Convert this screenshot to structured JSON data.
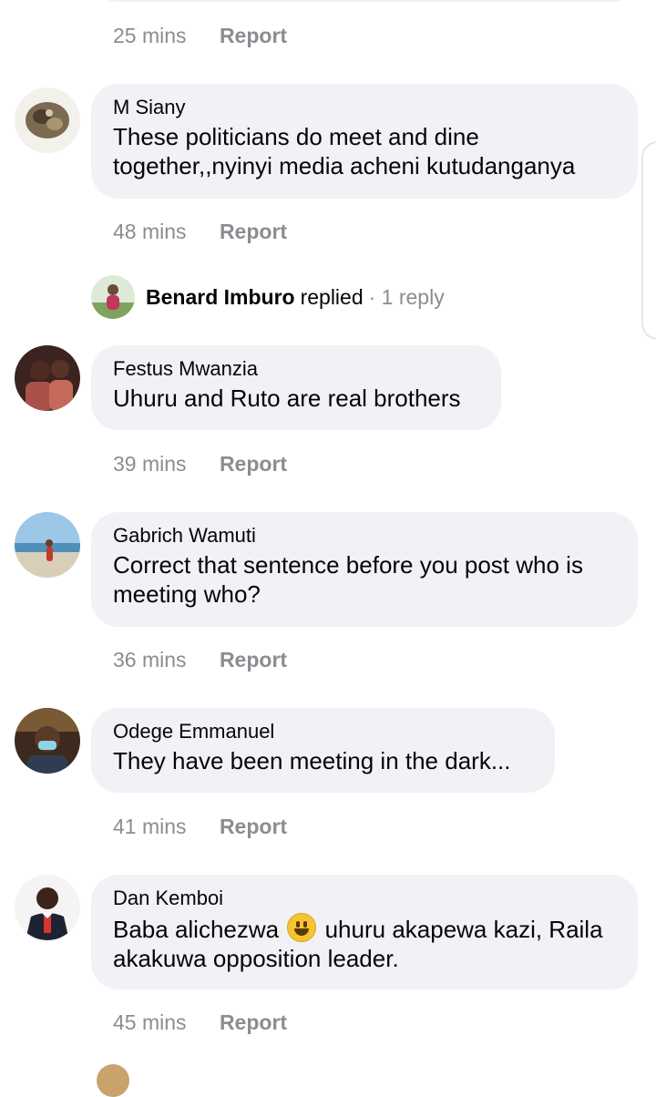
{
  "top_meta": {
    "time": "25 mins",
    "report": "Report"
  },
  "comments": [
    {
      "author": "M Siany",
      "text": "These politicians do meet and dine together,,nyinyi media acheni kutudanganya",
      "time": "48 mins",
      "report": "Report"
    },
    {
      "author": "Festus Mwanzia",
      "text": "Uhuru and Ruto are real brothers",
      "time": "39 mins",
      "report": "Report"
    },
    {
      "author": "Gabrich Wamuti",
      "text": "Correct that sentence before you post who is meeting who?",
      "time": "36 mins",
      "report": "Report"
    },
    {
      "author": "Odege Emmanuel",
      "text": "They have been meeting in the dark...",
      "time": "41 mins",
      "report": "Report"
    },
    {
      "author": "Dan Kemboi",
      "text_before_emoji": "Baba alichezwa",
      "text_after_emoji": "uhuru akapewa kazi, Raila akakuwa opposition leader.",
      "emoji": "grinning-face",
      "time": "45 mins",
      "report": "Report"
    }
  ],
  "reply_summary": {
    "name": "Benard Imburo",
    "verb": "replied",
    "count": "· 1 reply"
  },
  "colors": {
    "bubble": "#f0f2f5",
    "meta": "#8a8d91",
    "text": "#050505"
  }
}
